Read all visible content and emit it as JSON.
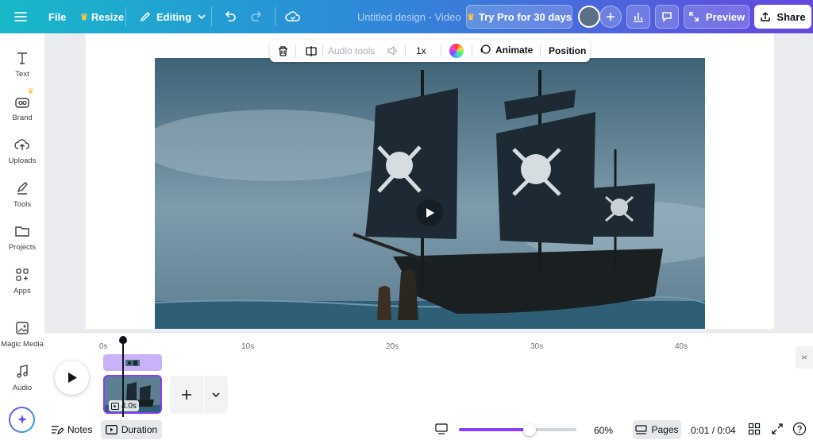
{
  "topbar": {
    "menu_icon": "hamburger-icon",
    "file_label": "File",
    "resize_label": "Resize",
    "editing_label": "Editing",
    "title": "Untitled design - Video",
    "try_pro_label": "Try Pro for 30 days",
    "preview_label": "Preview",
    "share_label": "Share"
  },
  "sidebar": {
    "items": [
      {
        "label": "Text",
        "icon": "text-icon"
      },
      {
        "label": "Brand",
        "icon": "brand-icon"
      },
      {
        "label": "Uploads",
        "icon": "cloud-upload-icon"
      },
      {
        "label": "Tools",
        "icon": "pen-tool-icon"
      },
      {
        "label": "Projects",
        "icon": "folder-icon"
      },
      {
        "label": "Apps",
        "icon": "apps-grid-icon"
      },
      {
        "label": "Magic Media",
        "icon": "magic-media-icon"
      },
      {
        "label": "Audio",
        "icon": "music-note-icon"
      }
    ]
  },
  "context_toolbar": {
    "audio_tools_label": "Audio tools",
    "speed_label": "1x",
    "animate_label": "Animate",
    "position_label": "Position"
  },
  "timeline": {
    "ticks": [
      "0s",
      "10s",
      "20s",
      "30s",
      "40s"
    ],
    "clip_duration": "4.0s"
  },
  "bottombar": {
    "notes_label": "Notes",
    "duration_label": "Duration",
    "zoom_level": "60%",
    "zoom_fraction": 0.6,
    "pages_label": "Pages",
    "time_readout": "0:01 / 0:04"
  },
  "colors": {
    "topbar_gradient_start": "#18b8c9",
    "topbar_gradient_end": "#6547e0",
    "accent_purple": "#8b3dff",
    "audio_track": "#c9b2f7"
  }
}
